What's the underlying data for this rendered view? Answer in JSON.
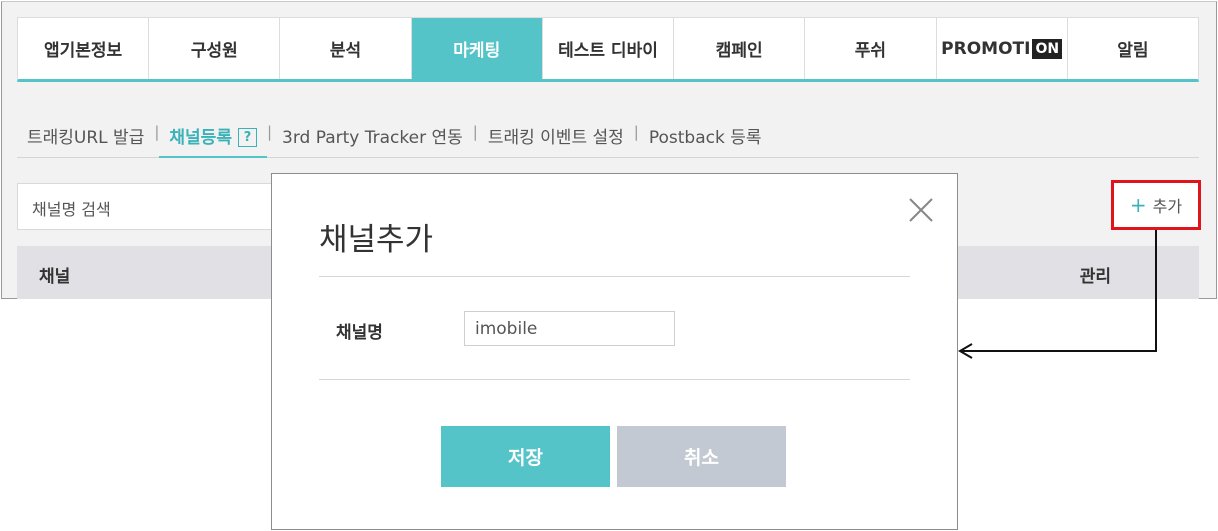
{
  "tabs": [
    {
      "label": "앱기본정보",
      "active": false
    },
    {
      "label": "구성원",
      "active": false
    },
    {
      "label": "분석",
      "active": false
    },
    {
      "label": "마케팅",
      "active": true
    },
    {
      "label": "테스트 디바이",
      "active": false
    },
    {
      "label": "캠페인",
      "active": false
    },
    {
      "label": "푸쉬",
      "active": false
    },
    {
      "label": "PROMOTI",
      "badge": "ON",
      "active": false
    },
    {
      "label": "알림",
      "active": false
    }
  ],
  "subnav": {
    "items": [
      {
        "label": "트래킹URL 발급"
      },
      {
        "label": "채널등록",
        "active": true,
        "help": "?"
      },
      {
        "label": "3rd Party Tracker 연동"
      },
      {
        "label": "트래킹 이벤트 설정"
      },
      {
        "label": "Postback 등록"
      }
    ],
    "separator": "|"
  },
  "search": {
    "placeholder": "채널명 검색"
  },
  "add_button": {
    "plus": "+",
    "label": "추가"
  },
  "table": {
    "columns": [
      "채널",
      "관리"
    ]
  },
  "modal": {
    "title": "채널추가",
    "field_label": "채널명",
    "field_value": "imobile",
    "save_label": "저장",
    "cancel_label": "취소"
  },
  "colors": {
    "accent": "#55c4c9",
    "highlight_border": "#e0141b",
    "cancel": "#c3c9d2"
  }
}
